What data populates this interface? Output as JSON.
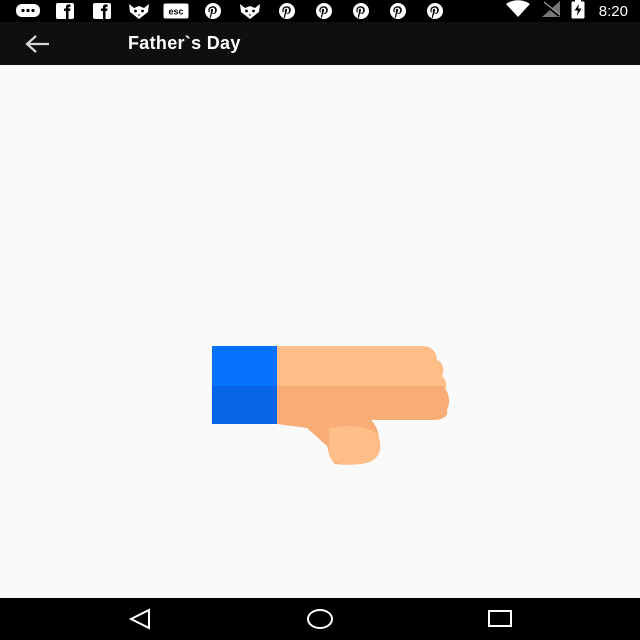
{
  "status_bar": {
    "notification_icons": [
      "chat-bubble-icon",
      "facebook-icon",
      "facebook-icon",
      "fox-icon",
      "esc-icon",
      "pinterest-icon",
      "fox-icon",
      "pinterest-icon",
      "pinterest-icon",
      "pinterest-icon",
      "pinterest-icon",
      "pinterest-icon"
    ],
    "esc_label": "esc",
    "time": "8:20"
  },
  "app_bar": {
    "title": "Father`s Day"
  },
  "content": {
    "image_icon": "thumbs-down-icon",
    "colors": {
      "cuff_light": "#0573fb",
      "cuff_dark": "#0665e6",
      "hand_light": "#ffbe87",
      "hand_dark": "#f7ad75",
      "background": "#fafafa"
    }
  },
  "nav_bar": {
    "buttons": [
      "back-triangle-icon",
      "home-circle-icon",
      "recents-square-icon"
    ]
  }
}
